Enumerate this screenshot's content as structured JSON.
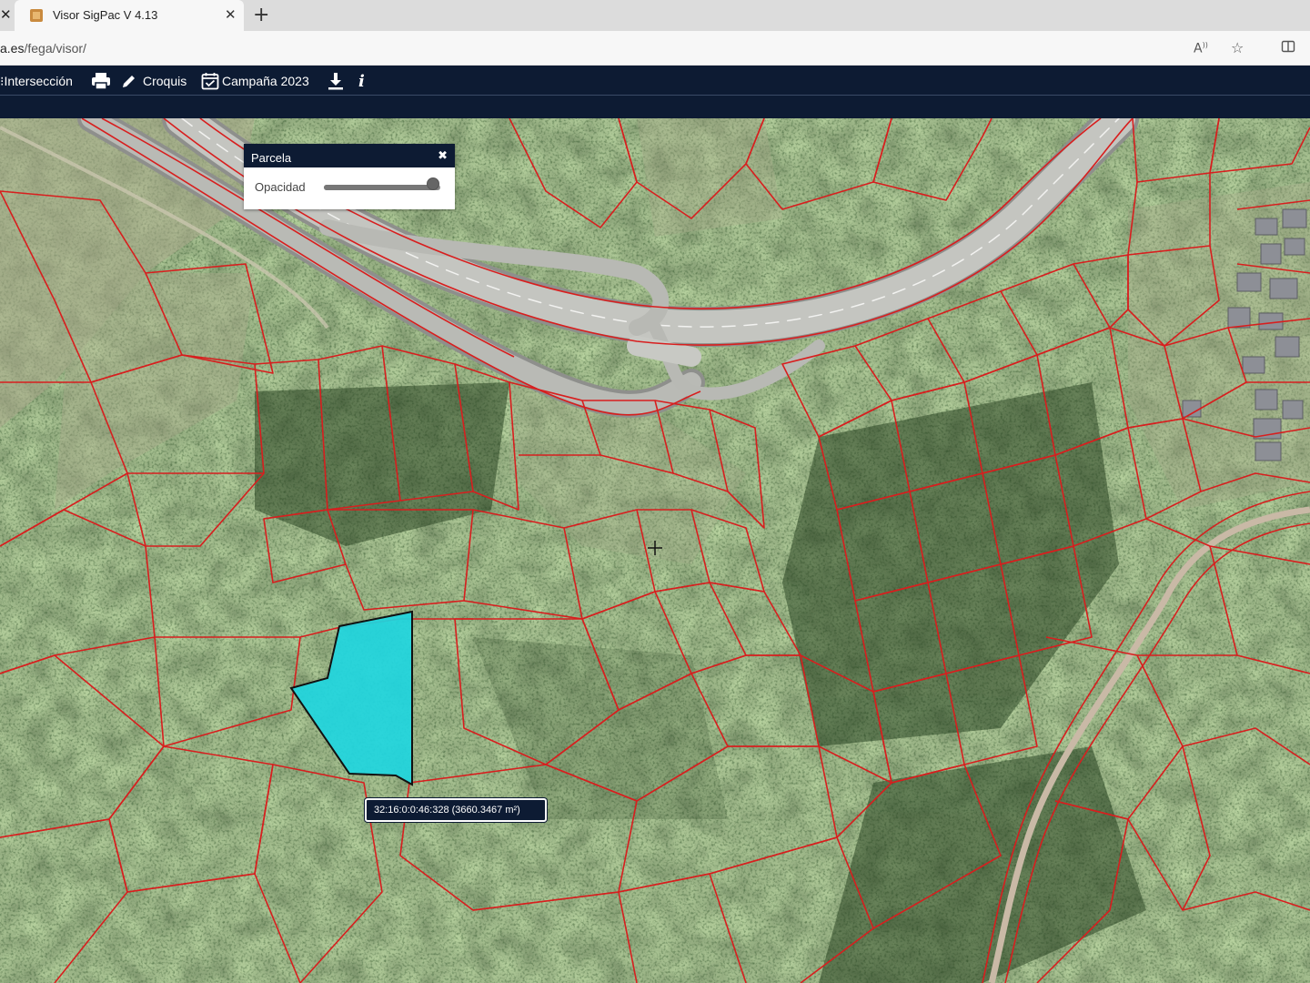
{
  "browser": {
    "tab_title": "Visor SigPac V 4.13",
    "url_host": "a.es",
    "url_path": "/fega/visor/",
    "icons": [
      "close-icon",
      "new-tab-icon",
      "read-aloud-icon",
      "favorite-star-icon",
      "split-screen-icon"
    ]
  },
  "toolbar": {
    "interseccion_label": "Intersección",
    "croquis_label": "Croquis",
    "campana_label": "Campaña 2023",
    "icons": [
      "intersection-icon",
      "print-icon",
      "pencil-icon",
      "calendar-check-icon",
      "download-icon",
      "info-icon"
    ]
  },
  "panel": {
    "title": "Parcela",
    "opacity_label": "Opacidad",
    "opacity_value": 1.0
  },
  "map": {
    "selected_parcel_label": "32:16:0:0:46:328 (3660.3467 m²)",
    "colors": {
      "parcel_border": "#d81e1e",
      "selected_parcel": "#1fd6e0",
      "toolbar": "#0d1b33"
    }
  }
}
